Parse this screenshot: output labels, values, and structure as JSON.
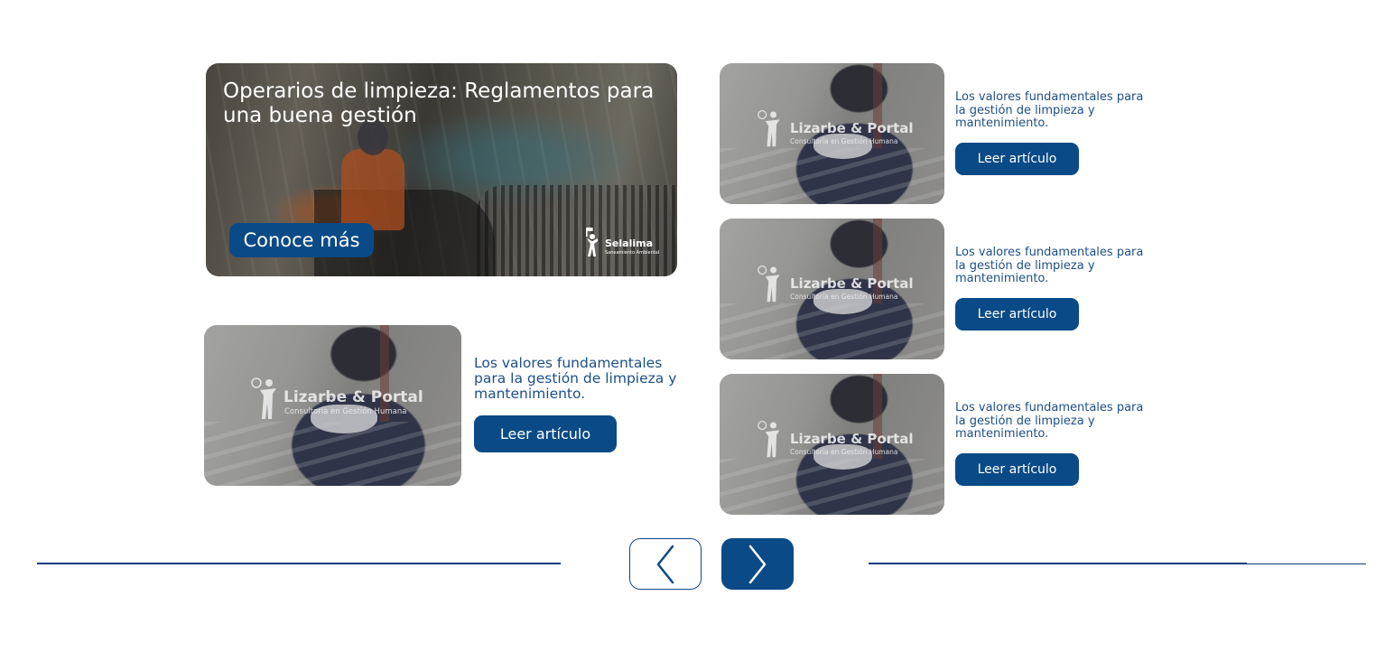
{
  "featured": {
    "title": "Operarios de limpieza: Reglamentos para una buena gestión",
    "cta_label": "Conoce más",
    "brand": {
      "name": "Selalima",
      "tagline": "Saneamiento Ambiental"
    }
  },
  "watermark": {
    "name": "Lizarbe & Portal",
    "tagline": "Consultoría en Gestión Humana"
  },
  "articles": [
    {
      "description": "Los valores fundamentales para la gestión de limpieza y mantenimiento.",
      "button_label": "Leer artículo"
    },
    {
      "description": "Los valores fundamentales para la gestión de limpieza y mantenimiento.",
      "button_label": "Leer artículo"
    },
    {
      "description": "Los valores fundamentales para la gestión de limpieza y mantenimiento.",
      "button_label": "Leer artículo"
    },
    {
      "description": "Los valores fundamentales para la gestión de limpieza y mantenimiento.",
      "button_label": "Leer artículo"
    }
  ],
  "pager": {
    "prev_icon": "chevron-left-icon",
    "next_icon": "chevron-right-icon"
  },
  "colors": {
    "primary": "#0a4a86",
    "text": "#1d4f86",
    "rule": "#0a3d7a",
    "background": "#ffffff"
  }
}
